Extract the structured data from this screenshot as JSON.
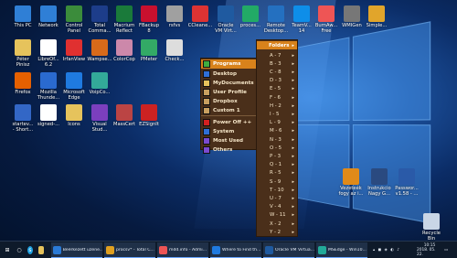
{
  "desktop_icons": [
    {
      "label": "This PC",
      "icon": "computer-icon",
      "color": "#2f7fd6"
    },
    {
      "label": "Network",
      "icon": "network-icon",
      "color": "#2f7fd6"
    },
    {
      "label": "Control\nPanel",
      "icon": "control-panel-icon",
      "color": "#3b8c3b"
    },
    {
      "label": "Total\nComma...",
      "icon": "floppy-icon",
      "color": "#1d3d8a"
    },
    {
      "label": "Macrium\nReflect",
      "icon": "macrium-icon",
      "color": "#1a7a3a"
    },
    {
      "label": "FBackup\n8",
      "icon": "backup-icon",
      "color": "#c8102e"
    },
    {
      "label": "rsfvs",
      "icon": "rsfvs-icon",
      "color": "#a0a0a0"
    },
    {
      "label": "CCleane...",
      "icon": "ccleaner-icon",
      "color": "#d33"
    },
    {
      "label": "Oracle\nVM Virt...",
      "icon": "virtualbox-icon",
      "color": "#1f5aa0"
    },
    {
      "label": "proces...",
      "icon": "process-icon",
      "color": "#2a6"
    },
    {
      "label": "Remote\nDesktop...",
      "icon": "remote-desktop-icon",
      "color": "#2470c0"
    },
    {
      "label": "TeamV...\n14",
      "icon": "teamviewer-icon",
      "color": "#0e8ee9"
    },
    {
      "label": "BurnAw...\nFree",
      "icon": "burnaware-icon",
      "color": "#e55"
    },
    {
      "label": "WMIGen",
      "icon": "wmigen-icon",
      "color": "#777"
    },
    {
      "label": "Simple...",
      "icon": "simple-icon",
      "color": "#e1a52b"
    },
    {
      "label": "Péter\nPinisz",
      "icon": "user-folder-icon",
      "color": "#e6c35c"
    },
    {
      "label": "LibreOf...\n6.2",
      "icon": "libreoffice-icon",
      "color": "#ffffff"
    },
    {
      "label": "IrfanView",
      "icon": "irfanview-icon",
      "color": "#e03030"
    },
    {
      "label": "Wampse...",
      "icon": "wamp-icon",
      "color": "#d86a1a"
    },
    {
      "label": "ColorCop",
      "icon": "colorcop-icon",
      "color": "#c8a"
    },
    {
      "label": "PMeter",
      "icon": "pmeter-icon",
      "color": "#3a6"
    },
    {
      "label": "Check...",
      "icon": "check-icon",
      "color": "#ddd"
    },
    {
      "label": "Firefox",
      "icon": "firefox-icon",
      "color": "#e66000"
    },
    {
      "label": "Mozilla\nThunde...",
      "icon": "thunderbird-icon",
      "color": "#2a6ad0"
    },
    {
      "label": "Microsoft\nEdge",
      "icon": "edge-icon",
      "color": "#1f7ae0"
    },
    {
      "label": "VoipCo...",
      "icon": "voip-icon",
      "color": "#3a9"
    },
    {
      "label": "startev...\n- Short...",
      "icon": "shortcut-icon",
      "color": "#3367c6"
    },
    {
      "label": "signed-...",
      "icon": "file-icon",
      "color": "#ffffff"
    },
    {
      "label": "Icons",
      "icon": "icons-folder-icon",
      "color": "#e6c35c"
    },
    {
      "label": "Visual\nStud...",
      "icon": "visual-studio-icon",
      "color": "#7b3fbe"
    },
    {
      "label": "MassCert",
      "icon": "masscert-icon",
      "color": "#b44"
    },
    {
      "label": "EZSignIt",
      "icon": "ezsignit-icon",
      "color": "#c22"
    }
  ],
  "right_icons": [
    {
      "label": "Vezeteék\nfogy az i...",
      "icon": "document-icon",
      "color": "#e08a1a"
    },
    {
      "label": "Instrukcio\nNagy G...",
      "icon": "document-icon",
      "color": "#2a4a80"
    },
    {
      "label": "Passwor...\nv1.58 - ...",
      "icon": "app-icon",
      "color": "#2a5aa8"
    },
    {
      "label": "Recycle\nBin",
      "icon": "recycle-bin-icon",
      "color": "#c9d6e6"
    }
  ],
  "menu": {
    "items": [
      {
        "label": "Programs",
        "color": "#3fae3f",
        "selected": true,
        "submenu": true
      },
      {
        "label": "Desktop",
        "color": "#2f6fd6",
        "selected": false,
        "submenu": true
      },
      {
        "label": "MyDocuments",
        "color": "#e6c35c",
        "selected": false,
        "submenu": true
      },
      {
        "label": "User Profile",
        "color": "#c8a060",
        "selected": false,
        "submenu": true
      },
      {
        "label": "Dropbox",
        "color": "#c8a060",
        "selected": false,
        "submenu": true
      },
      {
        "label": "Custom 1",
        "color": "#c8a060",
        "selected": false,
        "submenu": true
      },
      {
        "label": "Power Off ++",
        "color": "#d32020",
        "selected": false,
        "submenu": true
      },
      {
        "label": "System",
        "color": "#2f6fd6",
        "selected": false,
        "submenu": true
      },
      {
        "label": "Most Used",
        "color": "#7a4ad0",
        "selected": false,
        "submenu": true
      },
      {
        "label": "Others",
        "color": "#7a4ad0",
        "selected": false,
        "submenu": true
      }
    ]
  },
  "folders_menu": {
    "header": "Folders",
    "items": [
      "A - 7",
      "B - 3",
      "C - 8",
      "D - 3",
      "E - 5",
      "F - 6",
      "H - 2",
      "I - 5",
      "L - 9",
      "M - 6",
      "N - 3",
      "O - 5",
      "P - 3",
      "Q - 1",
      "R - 5",
      "S - 9",
      "T - 10",
      "U - 7",
      "V - 4",
      "W - 11",
      "X - 2",
      "Y - 2"
    ]
  },
  "taskbar": {
    "tasks": [
      {
        "label": "Beérkezett üzene...",
        "icon": "mail-icon",
        "color": "#2a7ad6"
      },
      {
        "label": "procsv* - Total C...",
        "icon": "total-commander-icon",
        "color": "#e0a020"
      },
      {
        "label": "mdd.info - Admi...",
        "icon": "browser-icon",
        "color": "#e55"
      },
      {
        "label": "Where to Find th...",
        "icon": "edge-icon",
        "color": "#1f7ae0"
      },
      {
        "label": "Oracle VM Virtua...",
        "icon": "virtualbox-icon",
        "color": "#1f5aa0"
      },
      {
        "label": "MSEdge - Win10...",
        "icon": "window-icon",
        "color": "#2a9"
      }
    ],
    "time": "10:15",
    "date": "2018. 05. 22."
  }
}
